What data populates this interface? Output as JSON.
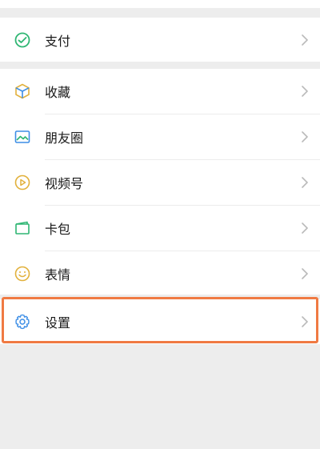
{
  "menu": {
    "pay": {
      "label": "支付",
      "icon": "pay-icon"
    },
    "items": [
      {
        "label": "收藏",
        "icon": "favorites-cube-icon"
      },
      {
        "label": "朋友圈",
        "icon": "moments-image-icon"
      },
      {
        "label": "视频号",
        "icon": "channels-play-icon"
      },
      {
        "label": "卡包",
        "icon": "card-wallet-icon"
      },
      {
        "label": "表情",
        "icon": "sticker-smile-icon"
      }
    ],
    "settings": {
      "label": "设置",
      "icon": "gear-icon"
    }
  },
  "colors": {
    "background": "#ededed",
    "row": "#ffffff",
    "highlight": "#f07a43",
    "green": "#2fb673",
    "blue": "#3d8ee6",
    "amber": "#e2b13c"
  }
}
